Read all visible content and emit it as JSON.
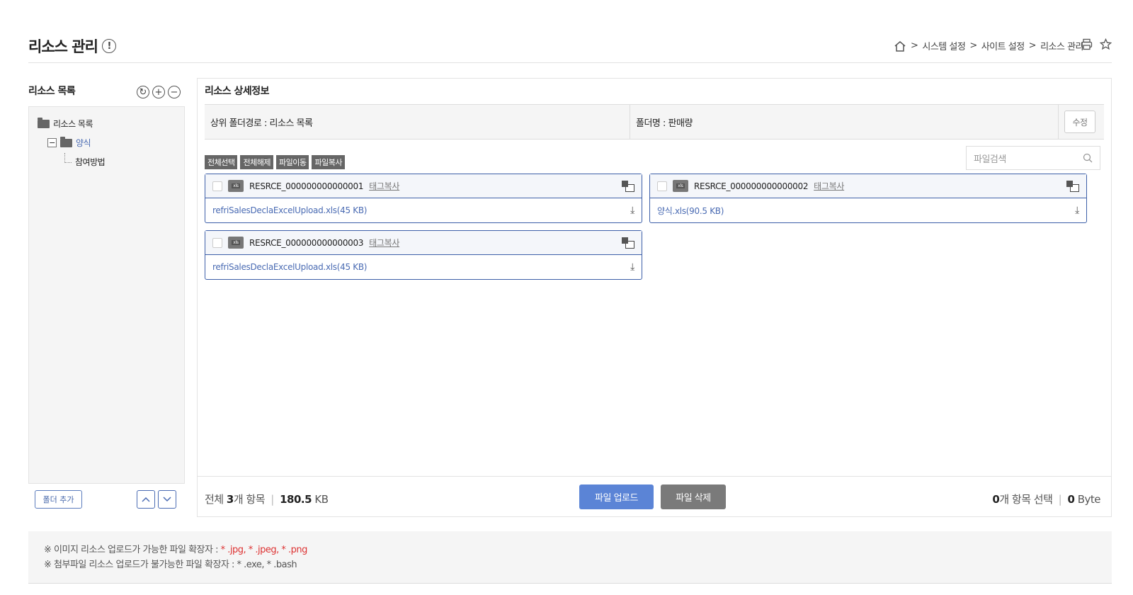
{
  "page": {
    "title": "리소스 관리",
    "info_glyph": "!"
  },
  "breadcrumb": {
    "home_icon": "home-icon",
    "items": [
      "시스템 설정",
      "사이트 설정",
      "리소스 관리"
    ],
    "separator": ">"
  },
  "left": {
    "title": "리소스 목록",
    "tree": [
      {
        "label": "리소스 목록"
      },
      {
        "label": "양식"
      },
      {
        "label": "참여방법"
      }
    ],
    "add_folder_label": "폴더 추가"
  },
  "detail": {
    "title": "리소스 상세정보",
    "parent_path_label": "상위 폴더경로 : 리소스 목록",
    "folder_name_label": "폴더명 : 판매량",
    "edit_label": "수정",
    "actions": [
      "전체선택",
      "전체해제",
      "파일이동",
      "파일복사"
    ],
    "search_placeholder": "파일검색",
    "tag_copy_label": "태그복사",
    "files": [
      {
        "id": "RESRCE_000000000000001",
        "file": "refriSalesDeclaExcelUpload.xls(45 KB)"
      },
      {
        "id": "RESRCE_000000000000002",
        "file": "양식.xls(90.5 KB)"
      },
      {
        "id": "RESRCE_000000000000003",
        "file": "refriSalesDeclaExcelUpload.xls(45 KB)"
      }
    ],
    "xls_badge": "xls"
  },
  "footer": {
    "total_prefix": "전체",
    "total_count": "3",
    "total_suffix": "개 항목",
    "total_size": "180.5",
    "total_unit": "KB",
    "upload_label": "파일 업로드",
    "delete_label": "파일 삭제",
    "selected_count": "0",
    "selected_suffix": "개 항목 선택",
    "selected_size": "0",
    "selected_unit": "Byte"
  },
  "notes": {
    "line1_prefix": "※ 이미지 리소스 업로드가 가능한 파일 확장자 : ",
    "line1_exts": "* .jpg, * .jpeg, * .png",
    "line2": "※ 첨부파일 리소스 업로드가 불가능한 파일 확장자 : * .exe, * .bash"
  }
}
